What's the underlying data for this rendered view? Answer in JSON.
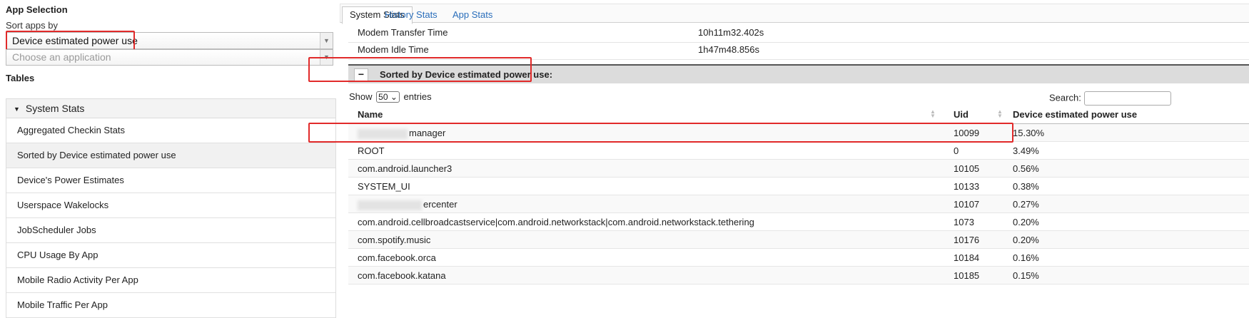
{
  "left": {
    "app_selection_heading": "App Selection",
    "sort_label": "Sort apps by",
    "sort_value": "Device estimated power use",
    "app_placeholder": "Choose an application",
    "tables_heading": "Tables",
    "group_label": "System Stats",
    "items": [
      "Aggregated Checkin Stats",
      "Sorted by Device estimated power use",
      "Device's Power Estimates",
      "Userspace Wakelocks",
      "JobScheduler Jobs",
      "CPU Usage By App",
      "Mobile Radio Activity Per App",
      "Mobile Traffic Per App"
    ],
    "active_item": "Sorted by Device estimated power use"
  },
  "tabs": [
    {
      "label": "System Stats",
      "active": true
    },
    {
      "label": "History Stats",
      "active": false
    },
    {
      "label": "App Stats",
      "active": false
    }
  ],
  "kv_rows": [
    {
      "key": "Modem Transfer Time",
      "value": "10h11m32.402s"
    },
    {
      "key": "Modem Idle Time",
      "value": "1h47m48.856s"
    }
  ],
  "section": {
    "toggle": "−",
    "title": "Sorted by Device estimated power use:"
  },
  "table_controls": {
    "show_prefix": "Show",
    "entries_value": "50",
    "show_suffix": "entries",
    "search_label": "Search:"
  },
  "table": {
    "columns": [
      "Name",
      "Uid",
      "Device estimated power use"
    ],
    "rows": [
      {
        "name": "manager",
        "name_redacted_prefix": true,
        "uid": "10099",
        "power": "15.30%"
      },
      {
        "name": "ROOT",
        "name_redacted_prefix": false,
        "uid": "0",
        "power": "3.49%"
      },
      {
        "name": "com.android.launcher3",
        "name_redacted_prefix": false,
        "uid": "10105",
        "power": "0.56%"
      },
      {
        "name": "SYSTEM_UI",
        "name_redacted_prefix": false,
        "uid": "10133",
        "power": "0.38%"
      },
      {
        "name": "ercenter",
        "name_redacted_prefix": true,
        "uid": "10107",
        "power": "0.27%"
      },
      {
        "name": "com.android.cellbroadcastservice|com.android.networkstack|com.android.networkstack.tethering",
        "name_redacted_prefix": false,
        "uid": "1073",
        "power": "0.20%"
      },
      {
        "name": "com.spotify.music",
        "name_redacted_prefix": false,
        "uid": "10176",
        "power": "0.20%"
      },
      {
        "name": "com.facebook.orca",
        "name_redacted_prefix": false,
        "uid": "10184",
        "power": "0.16%"
      },
      {
        "name": "com.facebook.katana",
        "name_redacted_prefix": false,
        "uid": "10185",
        "power": "0.15%"
      }
    ]
  },
  "colors": {
    "highlight": "#e12a2a",
    "link": "#2a6ebb",
    "section_bg": "#dcdcdc"
  }
}
